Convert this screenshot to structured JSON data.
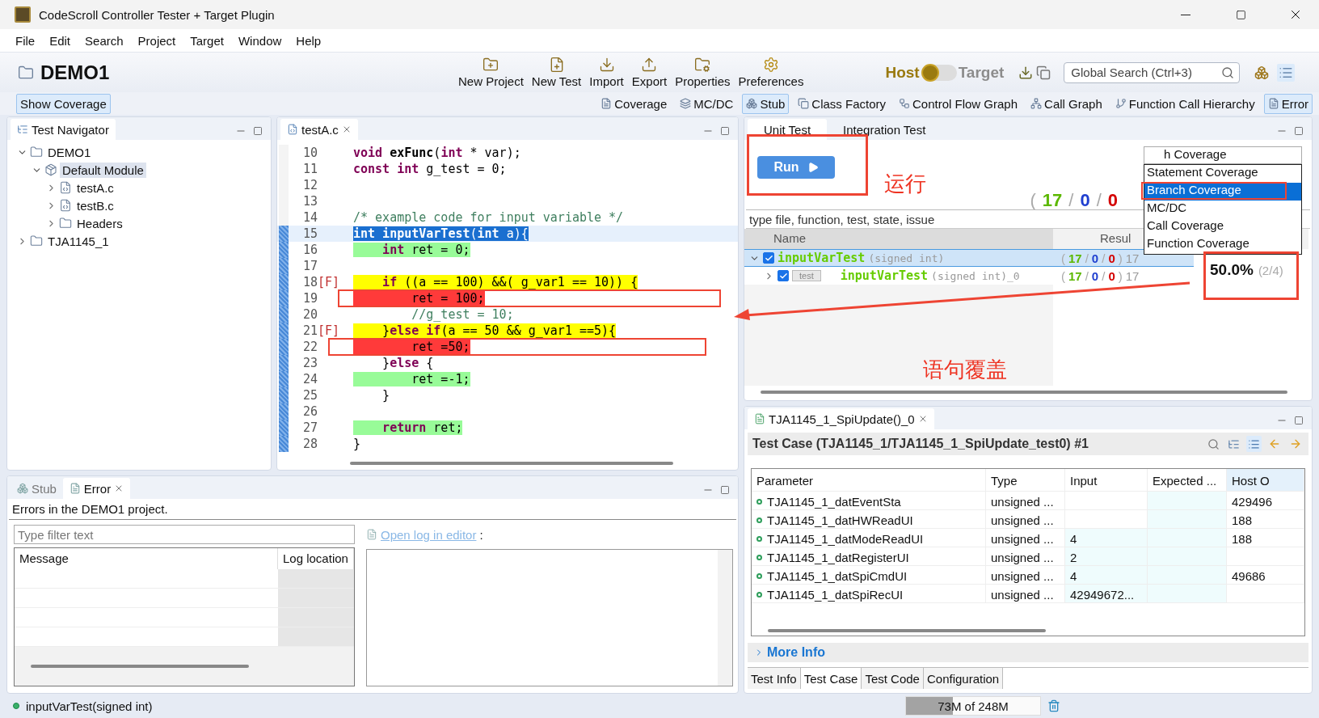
{
  "window": {
    "title": "CodeScroll Controller Tester + Target Plugin"
  },
  "menu": [
    "File",
    "Edit",
    "Search",
    "Project",
    "Target",
    "Window",
    "Help"
  ],
  "project": {
    "name": "DEMO1"
  },
  "toolbar": [
    {
      "label": "New Project",
      "kind": "new-project"
    },
    {
      "label": "New Test",
      "kind": "new-test"
    },
    {
      "label": "Import",
      "kind": "import"
    },
    {
      "label": "Export",
      "kind": "export"
    },
    {
      "label": "Properties",
      "kind": "properties"
    },
    {
      "label": "Preferences",
      "kind": "preferences"
    }
  ],
  "mode": [
    {
      "label": "Host",
      "selected": true
    },
    {
      "label": "Target",
      "selected": false
    }
  ],
  "global_search": {
    "placeholder": "Global Search (Ctrl+3)"
  },
  "show_coverage": {
    "label": "Show Coverage",
    "selected": true
  },
  "views": [
    {
      "label": "Coverage",
      "kind": "coverage",
      "selected": false
    },
    {
      "label": "MC/DC",
      "kind": "mcdc",
      "selected": false
    },
    {
      "label": "Stub",
      "kind": "stub",
      "selected": true
    },
    {
      "label": "Class Factory",
      "kind": "factory",
      "selected": false
    },
    {
      "label": "Control Flow Graph",
      "kind": "flow",
      "selected": false
    },
    {
      "label": "Call Graph",
      "kind": "graph",
      "selected": false
    },
    {
      "label": "Function Call Hierarchy",
      "kind": "hierarchy",
      "selected": false
    },
    {
      "label": "Error",
      "kind": "error",
      "selected": true
    }
  ],
  "navigator": {
    "title": "Test Navigator",
    "tree": [
      {
        "label": "DEMO1",
        "kind": "project",
        "expanded": true,
        "selected": false,
        "children": [
          {
            "label": "Default Module",
            "kind": "module",
            "expanded": true,
            "selected": true,
            "children": [
              {
                "label": "testA.c",
                "kind": "file",
                "expanded": false,
                "selected": false
              },
              {
                "label": "testB.c",
                "kind": "file",
                "expanded": false,
                "selected": false
              },
              {
                "label": "Headers",
                "kind": "folder",
                "expanded": false,
                "selected": false
              }
            ]
          }
        ]
      },
      {
        "label": "TJA1145_1",
        "kind": "project",
        "expanded": false,
        "selected": false
      }
    ]
  },
  "editor": {
    "tab": "testA.c",
    "lines": [
      {
        "number": "10",
        "kind": "plain",
        "range": false,
        "tokens": [
          {
            "kind": "kw",
            "text": "void"
          },
          {
            "kind": "fn",
            "text": " exFunc"
          },
          {
            "kind": "text",
            "text": "("
          },
          {
            "kind": "kw",
            "text": "int"
          },
          {
            "kind": "text",
            "text": " * var);"
          }
        ]
      },
      {
        "number": "11",
        "kind": "plain",
        "range": false,
        "tokens": [
          {
            "kind": "kw",
            "text": "const int"
          },
          {
            "kind": "text",
            "text": " g_test = 0;"
          }
        ]
      },
      {
        "number": "12",
        "kind": "plain",
        "range": false
      },
      {
        "number": "13",
        "kind": "plain",
        "range": false
      },
      {
        "number": "14",
        "kind": "plain",
        "range": false,
        "tokens": [
          {
            "kind": "comment",
            "text": "/* example code for input variable */"
          }
        ]
      },
      {
        "number": "15",
        "kind": "selected",
        "range": true,
        "tokens": [
          {
            "kind": "kw",
            "text": "int"
          },
          {
            "kind": "fn",
            "text": " inputVarTest"
          },
          {
            "kind": "text",
            "text": "("
          },
          {
            "kind": "kw",
            "text": "int"
          },
          {
            "kind": "text",
            "text": " a){"
          }
        ]
      },
      {
        "number": "16",
        "kind": "covered",
        "range": true,
        "tokens": [
          {
            "kind": "kw",
            "text": "    int"
          },
          {
            "kind": "text",
            "text": " ret = 0;"
          }
        ]
      },
      {
        "number": "17",
        "kind": "plain",
        "range": true
      },
      {
        "number": "18",
        "marker": "[F]",
        "kind": "partial",
        "range": true,
        "tokens": [
          {
            "kind": "kw",
            "text": "    if"
          },
          {
            "kind": "text",
            "text": " ((a == 100) &&( g_var1 == 10)) {"
          }
        ]
      },
      {
        "number": "19",
        "kind": "uncovered",
        "range": true,
        "tokens": [
          {
            "kind": "text",
            "text": "        ret = 100;"
          }
        ]
      },
      {
        "number": "20",
        "kind": "plain",
        "range": true,
        "tokens": [
          {
            "kind": "comment",
            "text": "        //g_test = 10;"
          }
        ]
      },
      {
        "number": "21",
        "marker": "[F]",
        "kind": "partial",
        "range": true,
        "tokens": [
          {
            "kind": "text",
            "text": "    }"
          },
          {
            "kind": "kw",
            "text": "else if"
          },
          {
            "kind": "text",
            "text": "(a == 50 && g_var1 ==5){"
          }
        ]
      },
      {
        "number": "22",
        "kind": "uncovered",
        "range": true,
        "tokens": [
          {
            "kind": "text",
            "text": "        ret =50;"
          }
        ]
      },
      {
        "number": "23",
        "kind": "plain",
        "range": true,
        "tokens": [
          {
            "kind": "text",
            "text": "    }"
          },
          {
            "kind": "kw",
            "text": "else"
          },
          {
            "kind": "text",
            "text": " {"
          }
        ]
      },
      {
        "number": "24",
        "kind": "covered",
        "range": true,
        "tokens": [
          {
            "kind": "text",
            "text": "        ret =-1;"
          }
        ]
      },
      {
        "number": "25",
        "kind": "plain",
        "range": true,
        "tokens": [
          {
            "kind": "text",
            "text": "    }"
          }
        ]
      },
      {
        "number": "26",
        "kind": "plain",
        "range": true
      },
      {
        "number": "27",
        "kind": "covered",
        "range": true,
        "tokens": [
          {
            "kind": "kw",
            "text": "    return"
          },
          {
            "kind": "text",
            "text": " ret;"
          }
        ]
      },
      {
        "number": "28",
        "kind": "plain",
        "range": true,
        "tokens": [
          {
            "kind": "text",
            "text": "}"
          }
        ]
      }
    ]
  },
  "unit_test": {
    "tabs": [
      {
        "label": "Unit Test",
        "selected": true
      },
      {
        "label": "Integration Test",
        "selected": false
      }
    ],
    "run_button": "Run",
    "stats": [
      {
        "kind": "punct",
        "text": "("
      },
      {
        "kind": "pass",
        "text": "17"
      },
      {
        "kind": "punct",
        "text": "/"
      },
      {
        "kind": "other",
        "text": "0"
      },
      {
        "kind": "punct",
        "text": "/"
      },
      {
        "kind": "fail",
        "text": "0"
      }
    ],
    "filter": {
      "placeholder": "type file, function, test, state, issue"
    },
    "columns": [
      "Name",
      "Resul"
    ],
    "rows": [
      {
        "name": "inputVarTest",
        "signature": "(signed int)",
        "checked": true,
        "expanded": true,
        "selected": true,
        "result": [
          {
            "kind": "punct",
            "text": "("
          },
          {
            "kind": "pass",
            "text": "17"
          },
          {
            "kind": "punct",
            "text": "/"
          },
          {
            "kind": "other",
            "text": "0"
          },
          {
            "kind": "punct",
            "text": "/"
          },
          {
            "kind": "fail",
            "text": "0"
          },
          {
            "kind": "punct",
            "text": ")"
          },
          {
            "kind": "total",
            "text": "17"
          }
        ],
        "children": [
          {
            "tag": "test",
            "name": "inputVarTest",
            "signature": "(signed int)_0",
            "checked": true,
            "expanded": false,
            "selected": false,
            "result": [
              {
                "kind": "punct",
                "text": "("
              },
              {
                "kind": "pass",
                "text": "17"
              },
              {
                "kind": "punct",
                "text": "/"
              },
              {
                "kind": "other",
                "text": "0"
              },
              {
                "kind": "punct",
                "text": "/"
              },
              {
                "kind": "fail",
                "text": "0"
              },
              {
                "kind": "punct",
                "text": ")"
              },
              {
                "kind": "total",
                "text": "17"
              }
            ]
          }
        ]
      }
    ],
    "coverage": {
      "value": "h Coverage",
      "options": [
        {
          "label": "Statement Coverage",
          "selected": false
        },
        {
          "label": "Branch Coverage",
          "selected": true
        },
        {
          "label": "MC/DC",
          "selected": false
        },
        {
          "label": "Call Coverage",
          "selected": false
        },
        {
          "label": "Function Coverage",
          "selected": false
        }
      ],
      "percent": "50.0%",
      "ratio": "(2/4)"
    }
  },
  "test_case": {
    "tab": "TJA1145_1_SpiUpdate()_0",
    "heading": "Test Case (TJA1145_1/TJA1145_1_SpiUpdate_test0) #1",
    "columns": [
      "Parameter",
      "Type",
      "Input",
      "Expected ...",
      "Host O"
    ],
    "rows": [
      [
        "TJA1145_1_datEventSta",
        "unsigned ...",
        "",
        "",
        "429496"
      ],
      [
        "TJA1145_1_datHWReadUI",
        "unsigned ...",
        "",
        "",
        "188"
      ],
      [
        "TJA1145_1_datModeReadUI",
        "unsigned ...",
        "4",
        "",
        "188"
      ],
      [
        "TJA1145_1_datRegisterUI",
        "unsigned ...",
        "2",
        "",
        ""
      ],
      [
        "TJA1145_1_datSpiCmdUI",
        "unsigned ...",
        "4",
        "",
        "49686"
      ],
      [
        "TJA1145_1_datSpiRecUI",
        "unsigned ...",
        "42949672...",
        "",
        ""
      ]
    ],
    "more_info": "More Info",
    "tabs": [
      {
        "label": "Test Info",
        "selected": false
      },
      {
        "label": "Test Case",
        "selected": true
      },
      {
        "label": "Test Code",
        "selected": false
      },
      {
        "label": "Configuration",
        "selected": false
      }
    ]
  },
  "error_view": {
    "tabs": [
      {
        "label": "Stub",
        "selected": false
      },
      {
        "label": "Error",
        "selected": true
      }
    ],
    "description": "Errors in the DEMO1 project.",
    "filter": {
      "placeholder": "Type filter text"
    },
    "columns": [
      "Message",
      "Log location"
    ],
    "link": "Open log in editor",
    "link_suffix": ":"
  },
  "status": {
    "text": "inputVarTest(signed int)",
    "memory": "73M of 248M",
    "level": 0.35
  },
  "annotations": {
    "labels": [
      "运行",
      "语句覆盖"
    ]
  }
}
